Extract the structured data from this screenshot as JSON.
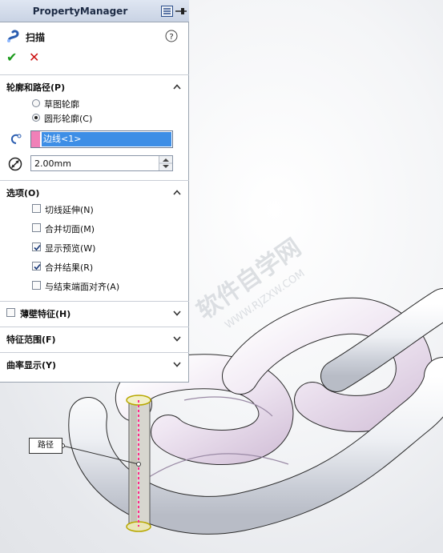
{
  "panel": {
    "title": "PropertyManager",
    "feature_name": "扫描",
    "ok_label": "✔",
    "cancel_label": "✕",
    "help_label": "?"
  },
  "profile_path": {
    "header": "轮廓和路径(P)",
    "radio_sketch": "草图轮廓",
    "radio_circle": "圆形轮廓(C)",
    "selected_radio": "圆形轮廓(C)",
    "path_selection": "边线<1>",
    "diameter_value": "2.00mm"
  },
  "options": {
    "header": "选项(O)",
    "items": [
      {
        "label": "切线延伸(N)",
        "checked": false
      },
      {
        "label": "合并切面(M)",
        "checked": false
      },
      {
        "label": "显示预览(W)",
        "checked": true
      },
      {
        "label": "合并结果(R)",
        "checked": true
      },
      {
        "label": "与结束端面对齐(A)",
        "checked": false
      }
    ]
  },
  "thin_feature": {
    "header": "薄壁特征(H)",
    "checked": false
  },
  "feature_scope": {
    "header": "特征范围(F)"
  },
  "curvature_display": {
    "header": "曲率显示(Y)"
  },
  "viewport": {
    "callout_label": "路径",
    "watermark_line1": "软件自学网",
    "watermark_line2": "WWW.RJZXW.COM"
  },
  "colors": {
    "accent_green": "#1a9a1a",
    "cancel_red": "#cc1010",
    "selection_blue": "#3d8ee6",
    "path_pink": "#f080b8",
    "path_dash": "#ff2a8a"
  }
}
